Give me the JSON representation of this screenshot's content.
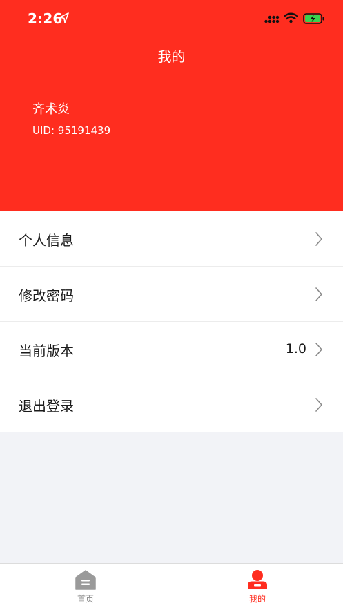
{
  "status_bar": {
    "time": "2:26",
    "icons": [
      "location-arrow-icon",
      "signal-icon",
      "wifi-icon",
      "battery-charging-icon"
    ]
  },
  "header": {
    "title": "我的",
    "user_name": "齐术炎",
    "uid": "UID: 95191439"
  },
  "menu": {
    "items": [
      {
        "label": "个人信息",
        "value": ""
      },
      {
        "label": "修改密码",
        "value": ""
      },
      {
        "label": "当前版本",
        "value": "1.0"
      },
      {
        "label": "退出登录",
        "value": ""
      }
    ]
  },
  "tab_bar": {
    "tabs": [
      {
        "label": "首页",
        "icon": "home-icon",
        "active": false
      },
      {
        "label": "我的",
        "icon": "profile-icon",
        "active": true
      }
    ]
  },
  "colors": {
    "accent": "#ff2d1f",
    "background": "#f2f3f7",
    "inactive": "#8a8a8a"
  }
}
